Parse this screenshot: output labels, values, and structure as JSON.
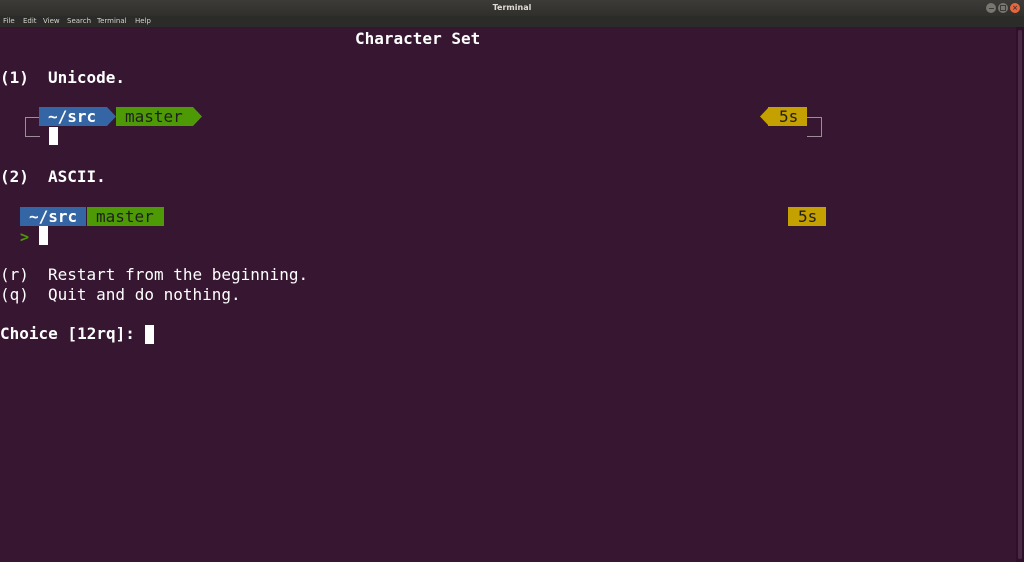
{
  "window": {
    "title": "Terminal"
  },
  "menu": [
    "File",
    "Edit",
    "View",
    "Search",
    "Terminal",
    "Help"
  ],
  "terminal": {
    "heading": "Character Set",
    "option1": {
      "key": "(1)",
      "label": "Unicode."
    },
    "option2": {
      "key": "(2)",
      "label": "ASCII."
    },
    "prompt": {
      "dir": "~/src",
      "branch": "master",
      "duration": "5s",
      "ascii_char": ">"
    },
    "restart": {
      "key": "(r)",
      "label": "Restart from the beginning."
    },
    "quit": {
      "key": "(q)",
      "label": "Quit and do nothing."
    },
    "choice": "Choice [12rq]:"
  },
  "colors": {
    "background": "#361631",
    "dir_segment": "#3465a4",
    "branch_segment": "#4e9a06",
    "duration_segment": "#c4a000"
  }
}
